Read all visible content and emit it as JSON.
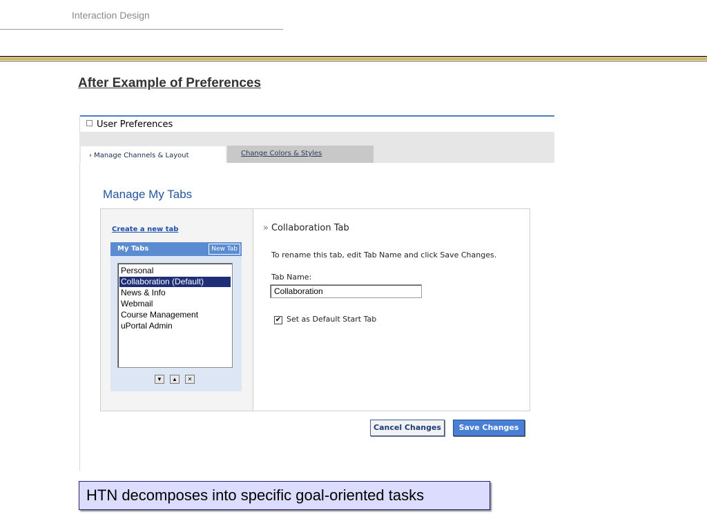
{
  "slide": {
    "header": "Interaction Design",
    "title": "After Example of Preferences",
    "callout": "HTN decomposes into specific goal-oriented tasks"
  },
  "preferences": {
    "window_title": "User Preferences",
    "tabs": [
      {
        "label": "› Manage Channels & Layout",
        "active": true
      },
      {
        "label": "Change Colors & Styles",
        "active": false
      }
    ],
    "section_heading": "Manage My Tabs",
    "create_link": "Create a new tab",
    "my_tabs_label": "My Tabs",
    "new_tab_button": "New Tab",
    "tab_list": [
      "Personal",
      "Collaboration (Default)",
      "News & Info",
      "Webmail",
      "Course Management",
      "uPortal Admin"
    ],
    "selected_index": 1,
    "controls": {
      "down": "▼",
      "up": "▲",
      "delete": "✕"
    },
    "editor": {
      "title": "Collaboration Tab",
      "instructions": "To rename this tab, edit Tab Name and click Save Changes.",
      "tab_name_label": "Tab Name:",
      "tab_name_value": "Collaboration",
      "default_checkbox_label": "Set as Default Start Tab",
      "default_checked": true
    },
    "buttons": {
      "cancel": "Cancel Changes",
      "save": "Save Changes"
    }
  },
  "colors": {
    "accent": "#2255a0",
    "selected": "#1e2f78",
    "save_button": "#4a7fd6",
    "callout_bg": "#dcdcff"
  }
}
